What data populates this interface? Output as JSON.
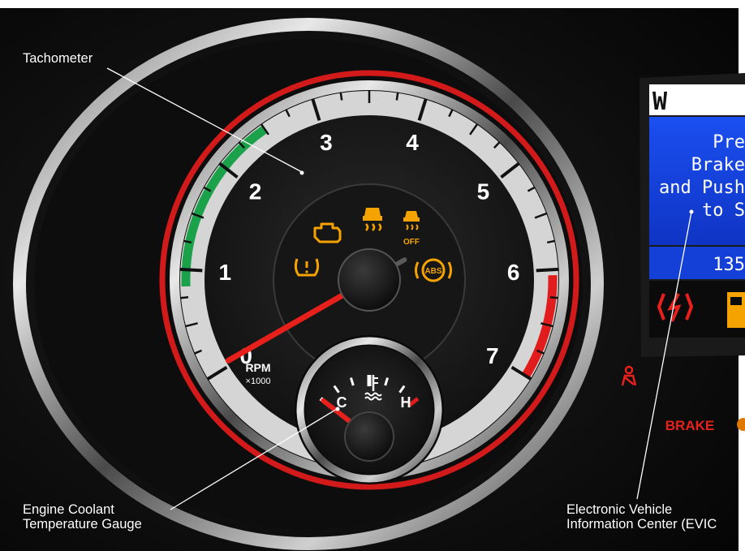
{
  "callouts": {
    "tachometer": "Tachometer",
    "coolant_line1": "Engine Coolant",
    "coolant_line2": "Temperature Gauge",
    "evic_line1": "Electronic Vehicle",
    "evic_line2": "Information Center (EVIC"
  },
  "tachometer": {
    "numerals": [
      "0",
      "1",
      "2",
      "3",
      "4",
      "5",
      "6",
      "7"
    ],
    "unit": "RPM",
    "multiplier": "×1000",
    "needle_rpm_thousands": 0.05
  },
  "coolant_gauge": {
    "cold_label": "C",
    "hot_label": "H",
    "needle_level": 0.0
  },
  "warning_lights": {
    "traction_off_label": "OFF",
    "abs_label": "ABS"
  },
  "evic": {
    "top_glyph": "W",
    "message": [
      "Pre",
      "Brake",
      "and Push",
      "to S"
    ],
    "odometer": "135"
  },
  "indicators": {
    "brake_label": "BRAKE"
  },
  "colors": {
    "accent_red": "#e01c1c",
    "warning_amber": "#f5a300",
    "gauge_green": "#1aa14a",
    "evic_blue": "#1540d8"
  }
}
